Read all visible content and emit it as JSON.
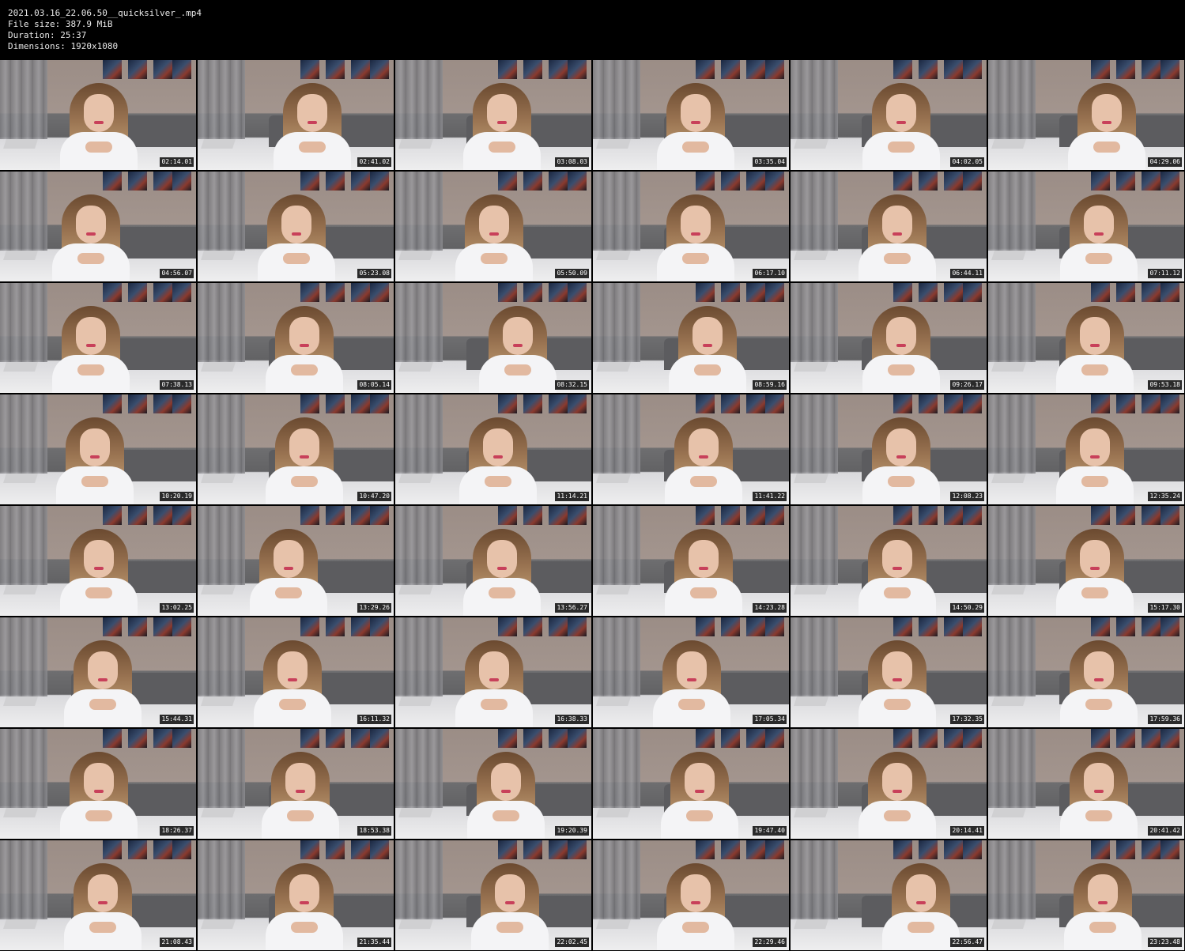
{
  "header": {
    "filename": "2021.03.16_22.06.50__quicksilver_.mp4",
    "file_size": "File size: 387.9 MiB",
    "duration": "Duration: 25:37",
    "dimensions": "Dimensions: 1920x1080"
  },
  "grid": {
    "columns": 6,
    "rows": 8
  },
  "thumbnails": [
    {
      "timestamp": "02:14.01"
    },
    {
      "timestamp": "02:41.02"
    },
    {
      "timestamp": "03:08.03"
    },
    {
      "timestamp": "03:35.04"
    },
    {
      "timestamp": "04:02.05"
    },
    {
      "timestamp": "04:29.06"
    },
    {
      "timestamp": "04:56.07"
    },
    {
      "timestamp": "05:23.08"
    },
    {
      "timestamp": "05:50.09"
    },
    {
      "timestamp": "06:17.10"
    },
    {
      "timestamp": "06:44.11"
    },
    {
      "timestamp": "07:11.12"
    },
    {
      "timestamp": "07:38.13"
    },
    {
      "timestamp": "08:05.14"
    },
    {
      "timestamp": "08:32.15"
    },
    {
      "timestamp": "08:59.16"
    },
    {
      "timestamp": "09:26.17"
    },
    {
      "timestamp": "09:53.18"
    },
    {
      "timestamp": "10:20.19"
    },
    {
      "timestamp": "10:47.20"
    },
    {
      "timestamp": "11:14.21"
    },
    {
      "timestamp": "11:41.22"
    },
    {
      "timestamp": "12:08.23"
    },
    {
      "timestamp": "12:35.24"
    },
    {
      "timestamp": "13:02.25"
    },
    {
      "timestamp": "13:29.26"
    },
    {
      "timestamp": "13:56.27"
    },
    {
      "timestamp": "14:23.28"
    },
    {
      "timestamp": "14:50.29"
    },
    {
      "timestamp": "15:17.30"
    },
    {
      "timestamp": "15:44.31"
    },
    {
      "timestamp": "16:11.32"
    },
    {
      "timestamp": "16:38.33"
    },
    {
      "timestamp": "17:05.34"
    },
    {
      "timestamp": "17:32.35"
    },
    {
      "timestamp": "17:59.36"
    },
    {
      "timestamp": "18:26.37"
    },
    {
      "timestamp": "18:53.38"
    },
    {
      "timestamp": "19:20.39"
    },
    {
      "timestamp": "19:47.40"
    },
    {
      "timestamp": "20:14.41"
    },
    {
      "timestamp": "20:41.42"
    },
    {
      "timestamp": "21:08.43"
    },
    {
      "timestamp": "21:35.44"
    },
    {
      "timestamp": "22:02.45"
    },
    {
      "timestamp": "22:29.46"
    },
    {
      "timestamp": "22:56.47"
    },
    {
      "timestamp": "23:23.48"
    }
  ],
  "colors": {
    "background": "#000000",
    "header_text": "#e8e8e8",
    "timestamp_text": "#ffffff",
    "timestamp_bg": "#000000"
  }
}
